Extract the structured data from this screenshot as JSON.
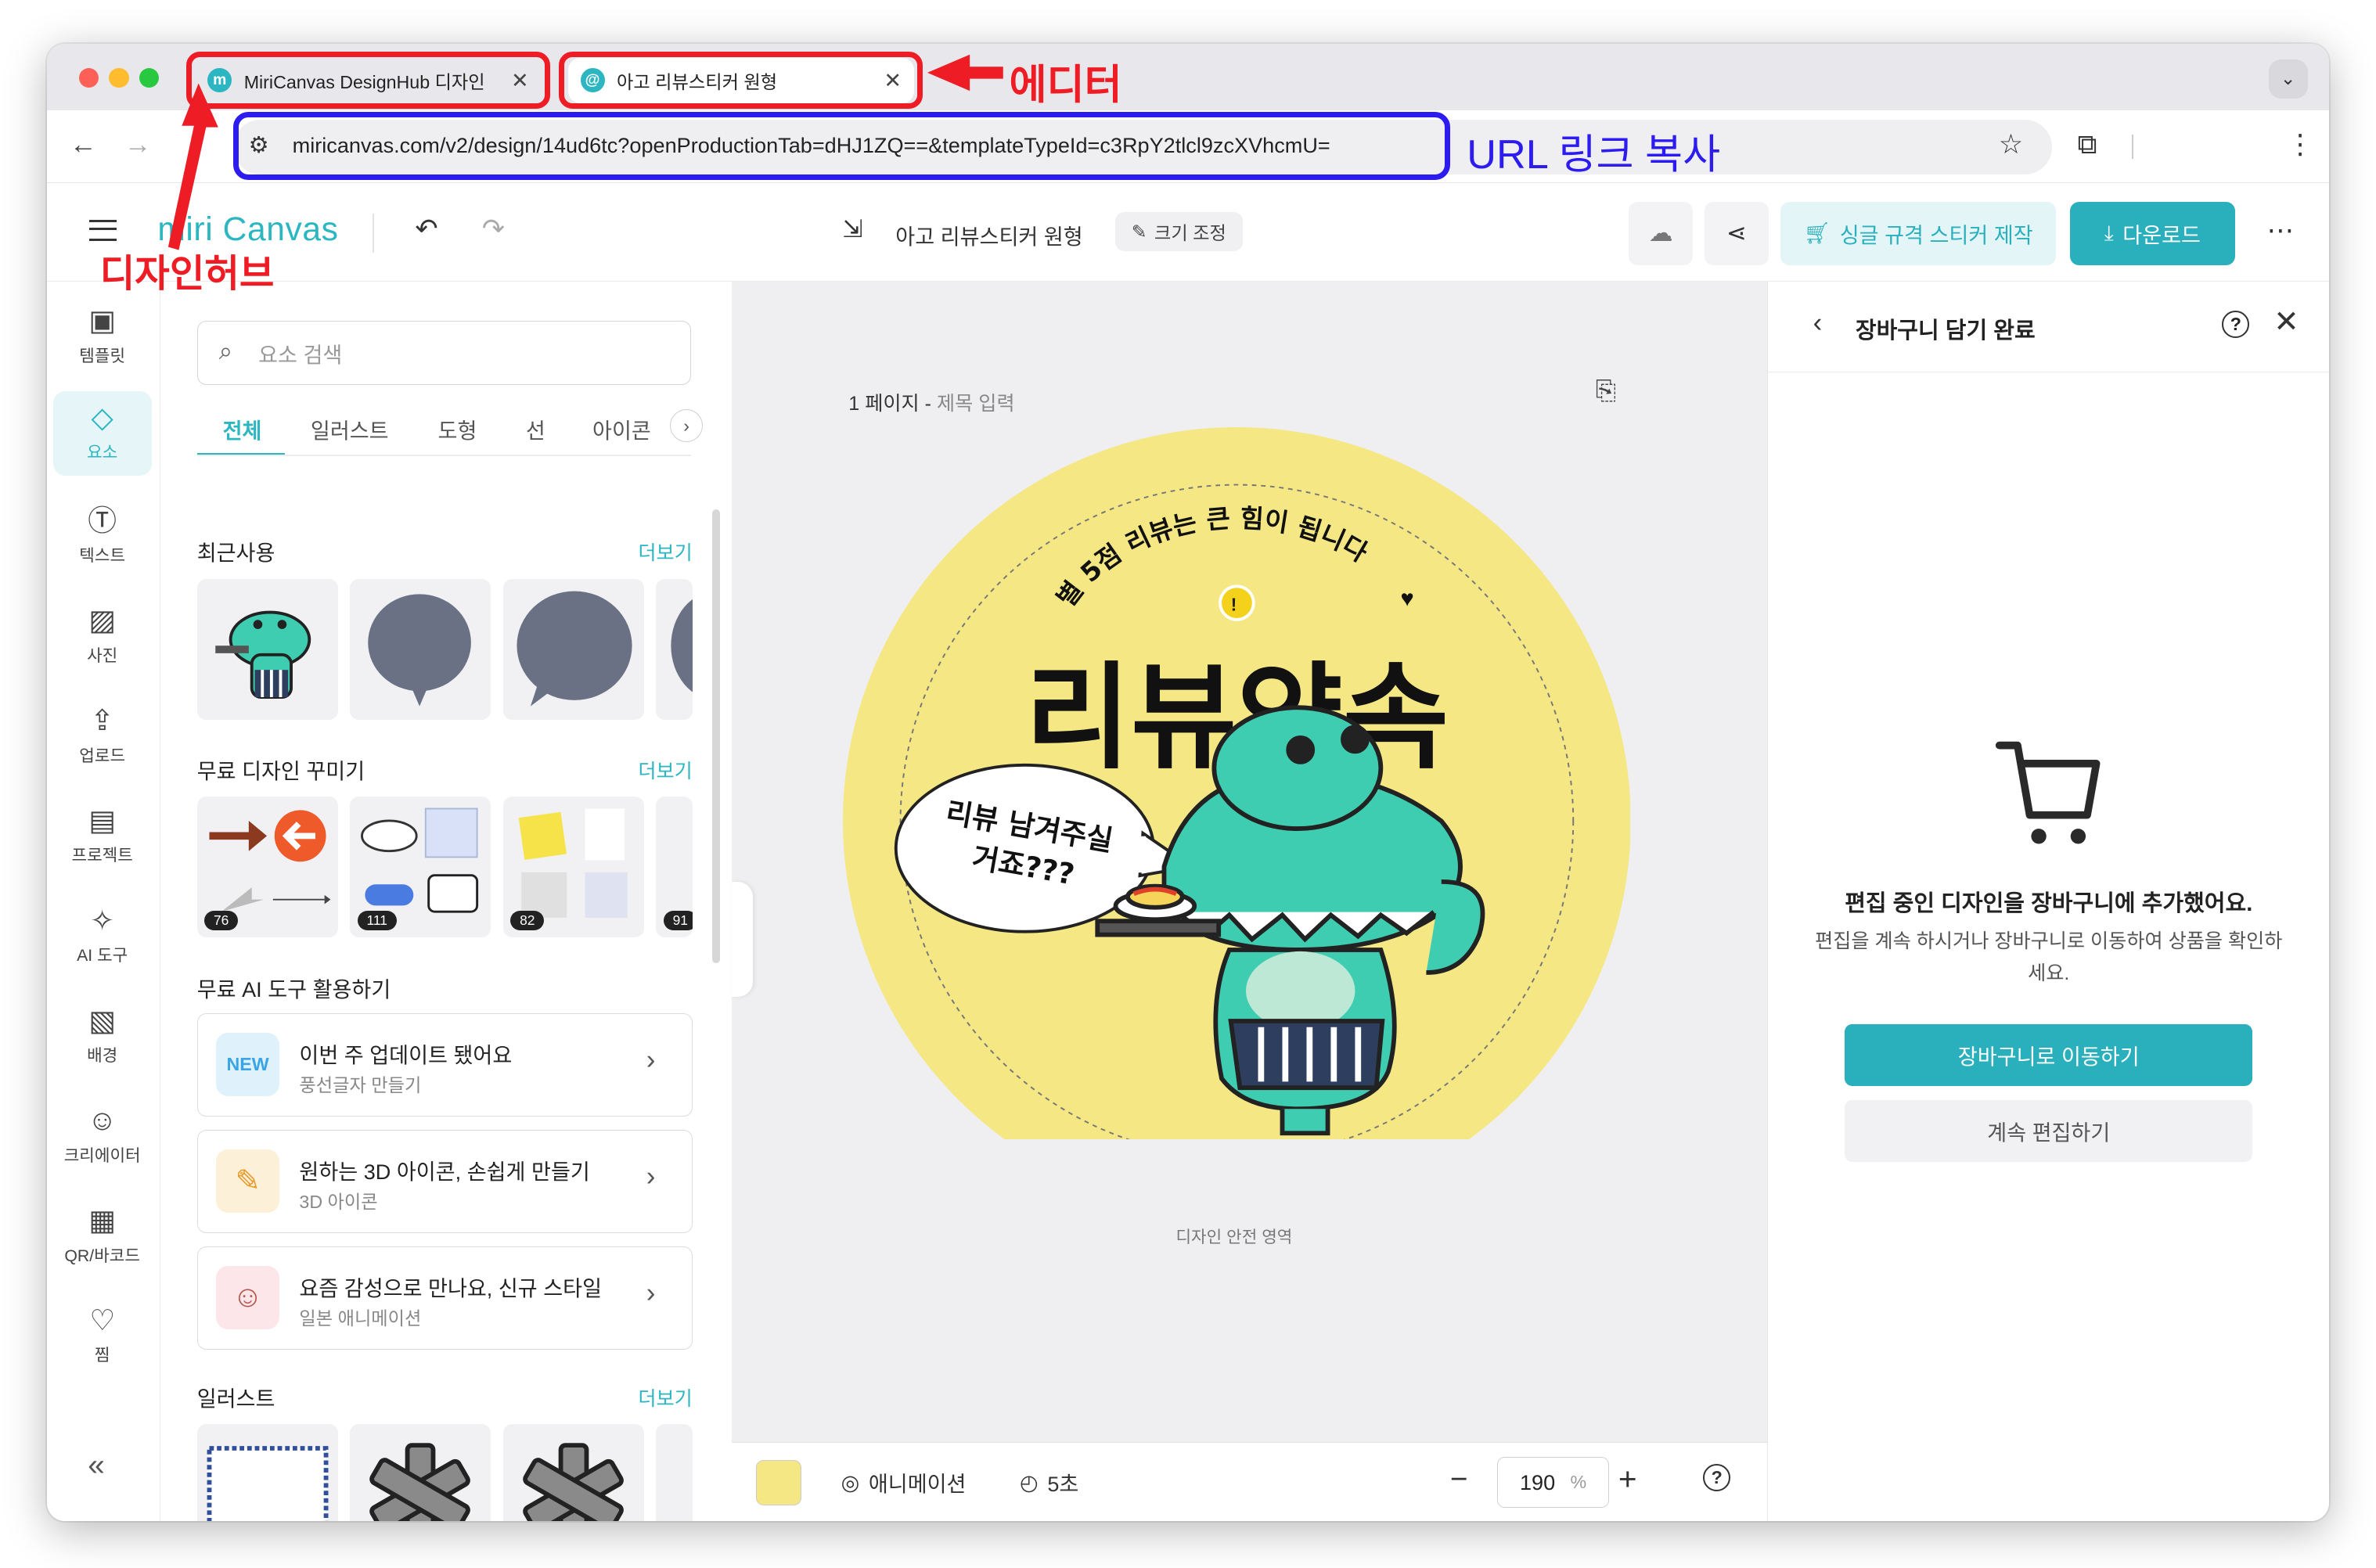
{
  "browser": {
    "tabs": [
      {
        "title": "MiriCanvas DesignHub 디자인",
        "favicon": "m"
      },
      {
        "title": "아고 리뷰스티커 원형",
        "favicon": "@"
      }
    ],
    "url": "miricanvas.com/v2/design/14ud6tc?openProductionTab=dHJ1ZQ==&templateTypeId=c3RpY2tlcl9zcXVhcmU="
  },
  "annotations": {
    "editor": "에디터",
    "url_copy": "URL 링크 복사",
    "designhub": "디자인허브"
  },
  "header": {
    "logo": "miri Canvas",
    "design_title": "아고 리뷰스티커 원형",
    "resize_label": "크기 조정",
    "make_label": "싱글 규격 스티커 제작",
    "download_label": "다운로드"
  },
  "rail": {
    "items": [
      {
        "label": "템플릿",
        "icon": "template-icon"
      },
      {
        "label": "요소",
        "icon": "elements-icon"
      },
      {
        "label": "텍스트",
        "icon": "text-icon"
      },
      {
        "label": "사진",
        "icon": "photo-icon"
      },
      {
        "label": "업로드",
        "icon": "upload-icon"
      },
      {
        "label": "프로젝트",
        "icon": "project-icon"
      },
      {
        "label": "AI 도구",
        "icon": "ai-tool-icon"
      },
      {
        "label": "배경",
        "icon": "background-icon"
      },
      {
        "label": "크리에이터",
        "icon": "creator-icon"
      },
      {
        "label": "QR/바코드",
        "icon": "qr-icon"
      },
      {
        "label": "찜",
        "icon": "heart-icon"
      }
    ]
  },
  "panel": {
    "search_placeholder": "요소 검색",
    "tabs": [
      "전체",
      "일러스트",
      "도형",
      "선",
      "아이콘"
    ],
    "more_label": "더보기",
    "sections": {
      "recent": "최근사용",
      "free_deco": "무료 디자인 꾸미기",
      "free_ai": "무료 AI 도구 활용하기",
      "illust": "일러스트"
    },
    "deco_counts": [
      "76",
      "111",
      "82",
      "91"
    ],
    "ai_cards": [
      {
        "title": "이번 주 업데이트 됐어요",
        "sub": "풍선글자 만들기",
        "badge": "NEW"
      },
      {
        "title": "원하는 3D 아이콘, 손쉽게 만들기",
        "sub": "3D 아이콘"
      },
      {
        "title": "요즘 감성으로 만나요, 신규 스타일",
        "sub": "일본 애니메이션"
      }
    ]
  },
  "canvas": {
    "page_label": "1 페이지 -",
    "page_title_placeholder": "제목 입력",
    "arc_text": "별 5점 리뷰는 큰 힘이 됩니다",
    "headline": "리뷰약속",
    "bubble_line1": "리뷰 남겨주실",
    "bubble_line2": "거죠???",
    "safe_area_label": "디자인 안전 영역",
    "bg_color": "#f4e784",
    "char_color": "#3fcdb2"
  },
  "bottom": {
    "animation_label": "애니메이션",
    "duration_label": "5초",
    "zoom_value": "190",
    "zoom_unit": "%"
  },
  "cart": {
    "title": "장바구니 담기 완료",
    "message": "편집 중인 디자인을 장바구니에 추가했어요.",
    "sub_line1": "편집을 계속 하시거나 장바구니로 이동하여 상품을 확인하",
    "sub_line2": "세요.",
    "go_cart_label": "장바구니로 이동하기",
    "continue_label": "계속 편집하기"
  },
  "colors": {
    "brand": "#2bb6c1",
    "annotation_red": "#ee1c24",
    "annotation_blue": "#2d1cf0"
  }
}
